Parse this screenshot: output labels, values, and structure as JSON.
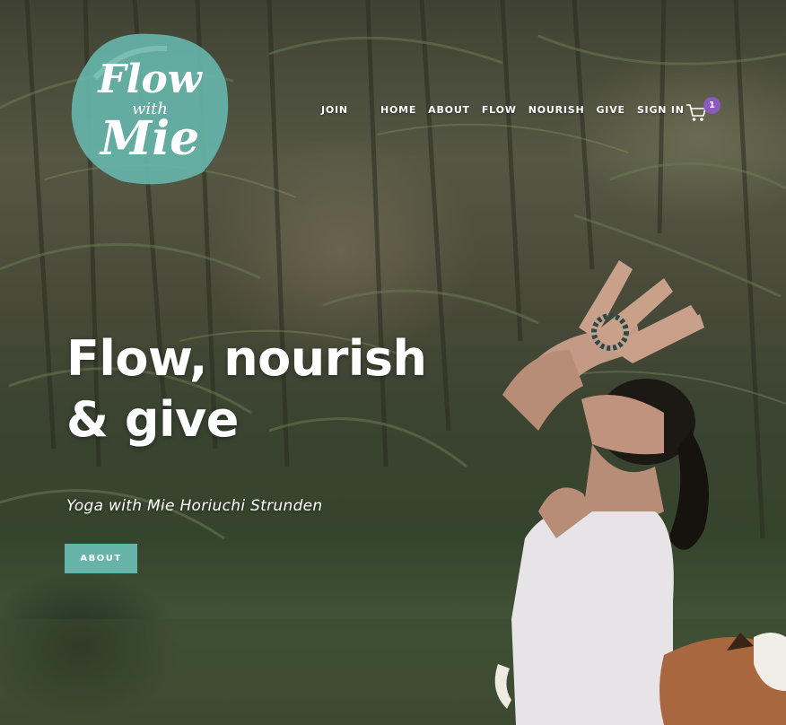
{
  "logo": {
    "line1": "Flow",
    "line2": "with",
    "line3": "Mie",
    "color": "#66b4a9"
  },
  "nav": {
    "items": [
      {
        "label": "JOIN"
      },
      {
        "label": "HOME"
      },
      {
        "label": "ABOUT"
      },
      {
        "label": "FLOW"
      },
      {
        "label": "NOURISH"
      },
      {
        "label": "GIVE"
      },
      {
        "label": "SIGN IN"
      }
    ]
  },
  "cart": {
    "icon": "cart-icon",
    "count": "1",
    "badge_color": "#8a5ac0"
  },
  "hero": {
    "title_line1": "Flow, nourish",
    "title_line2": "& give",
    "subtitle": "Yoga with Mie Horiuchi Strunden",
    "button_label": "ABOUT",
    "button_color": "#66b4a9"
  }
}
